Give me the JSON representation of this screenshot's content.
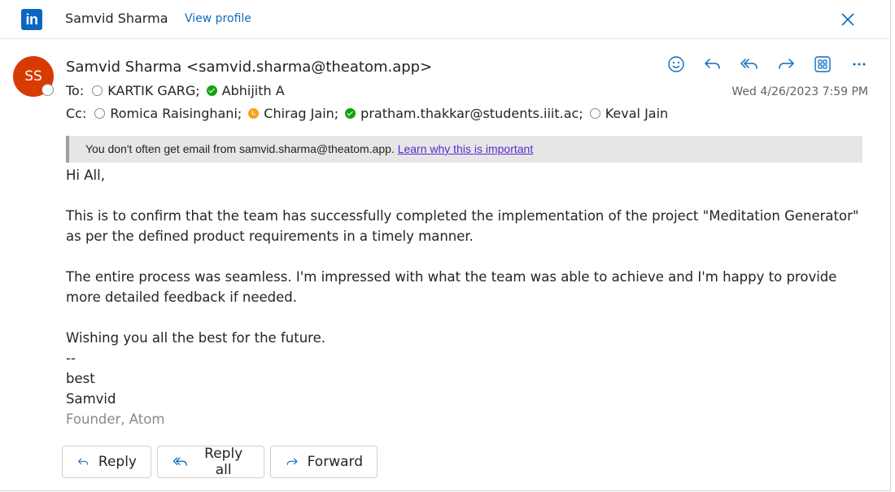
{
  "header": {
    "logo_text": "in",
    "name": "Samvid Sharma",
    "view_profile": "View profile"
  },
  "sender": {
    "initials": "SS",
    "from": "Samvid Sharma <samvid.sharma@theatom.app>",
    "date": "Wed 4/26/2023 7:59 PM"
  },
  "to": {
    "label": "To:",
    "recipients": [
      {
        "name": "KARTIK GARG;",
        "status": "offline"
      },
      {
        "name": "Abhijith A",
        "status": "available"
      }
    ]
  },
  "cc": {
    "label": "Cc:",
    "recipients": [
      {
        "name": "Romica Raisinghani;",
        "status": "offline"
      },
      {
        "name": "Chirag Jain;",
        "status": "away"
      },
      {
        "name": "pratham.thakkar@students.iiit.ac;",
        "status": "available"
      },
      {
        "name": "Keval Jain",
        "status": "offline"
      }
    ]
  },
  "toolbar": [
    "emoji-icon",
    "reply-icon",
    "reply-all-icon",
    "forward-icon",
    "apps-icon",
    "more-icon"
  ],
  "banner": {
    "text": "You don't often get email from samvid.sharma@theatom.app.",
    "link": "Learn why this is important"
  },
  "body": {
    "greeting": "Hi All,",
    "para1_line1": "This is to confirm that the team has successfully completed the implementation of the project \"Meditation Generator\"",
    "para1_line2": "as per the defined product requirements in a timely manner.",
    "para2_line1": "The entire process was seamless. I'm impressed with what the team was able to achieve and I'm happy to provide",
    "para2_line2": "more detailed feedback if needed.",
    "wish": "Wishing you all the best for the future.",
    "sig_sep": "--",
    "sig_closing": "best",
    "sig_name": "Samvid",
    "sig_title": "Founder, Atom"
  },
  "actions": {
    "reply": "Reply",
    "reply_all": "Reply all",
    "forward": "Forward"
  },
  "colors": {
    "accent": "#0f6cbd",
    "avatar": "#d83b01",
    "linkedin": "#0a66c2",
    "available": "#13a10e",
    "away": "#f7a21b"
  }
}
